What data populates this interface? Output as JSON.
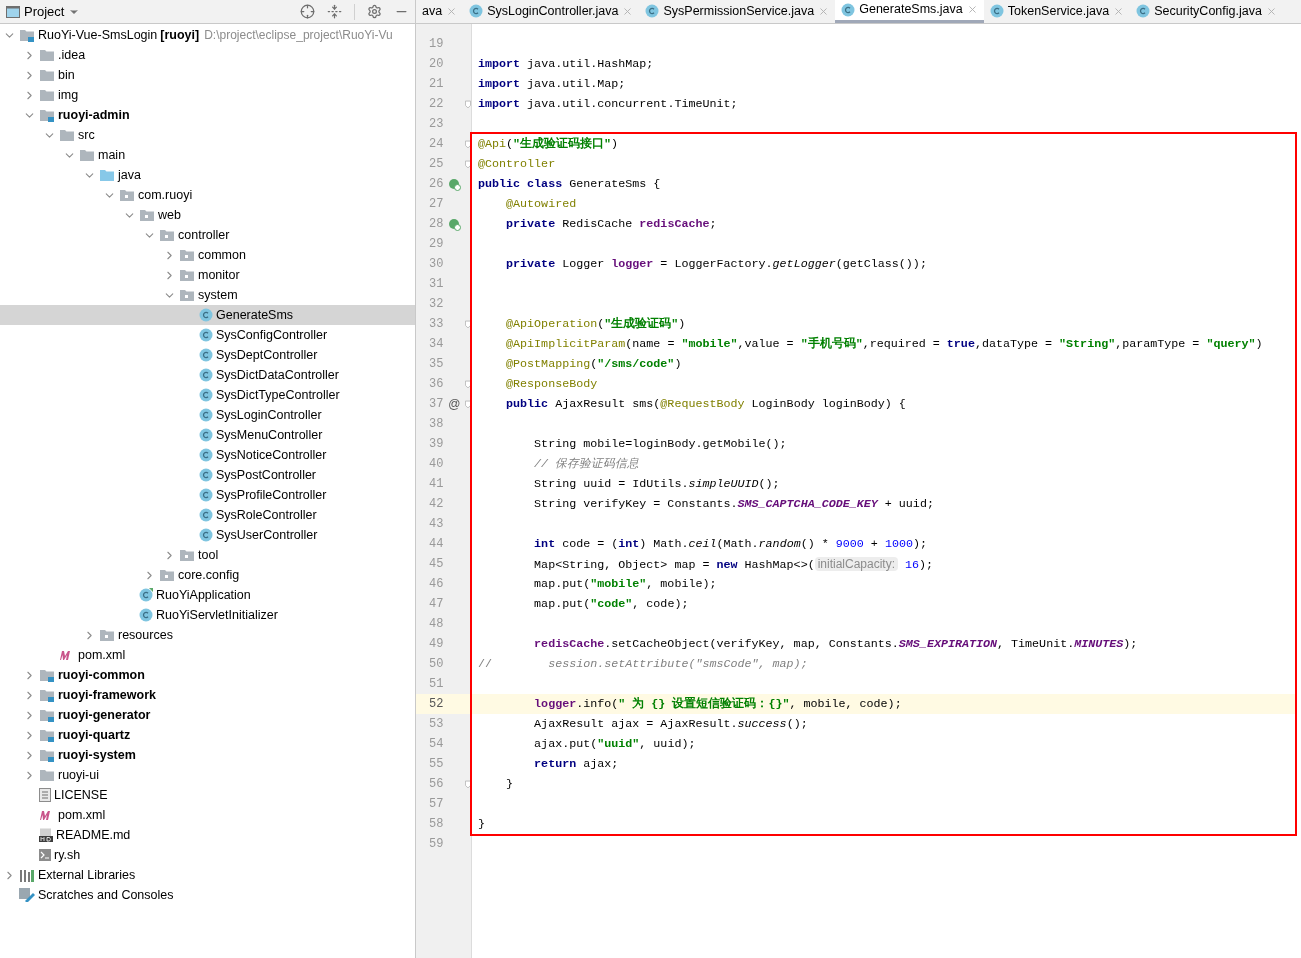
{
  "project_panel": {
    "title": "Project"
  },
  "tree": [
    {
      "kind": "module",
      "name": "RuoYi-Vue-SmsLogin",
      "tag": "[ruoyi]",
      "path": "D:\\project\\eclipse_project\\RuoYi-Vu",
      "expanded": true,
      "selected": false,
      "children": [
        {
          "kind": "folder",
          "name": ".idea",
          "expanded": false,
          "selected": false
        },
        {
          "kind": "folder",
          "name": "bin",
          "expanded": false,
          "selected": false
        },
        {
          "kind": "folder",
          "name": "img",
          "expanded": false,
          "selected": false
        },
        {
          "kind": "module",
          "name": "ruoyi-admin",
          "expanded": true,
          "selected": false,
          "children": [
            {
              "kind": "folder",
              "name": "src",
              "expanded": true,
              "selected": false,
              "children": [
                {
                  "kind": "folder",
                  "name": "main",
                  "expanded": true,
                  "selected": false,
                  "children": [
                    {
                      "kind": "source",
                      "name": "java",
                      "expanded": true,
                      "selected": false,
                      "children": [
                        {
                          "kind": "package",
                          "name": "com.ruoyi",
                          "expanded": true,
                          "selected": false,
                          "children": [
                            {
                              "kind": "package",
                              "name": "web",
                              "expanded": true,
                              "selected": false,
                              "children": [
                                {
                                  "kind": "package",
                                  "name": "controller",
                                  "expanded": true,
                                  "selected": false,
                                  "children": [
                                    {
                                      "kind": "package",
                                      "name": "common",
                                      "expanded": false,
                                      "selected": false
                                    },
                                    {
                                      "kind": "package",
                                      "name": "monitor",
                                      "expanded": false,
                                      "selected": false
                                    },
                                    {
                                      "kind": "package",
                                      "name": "system",
                                      "expanded": true,
                                      "selected": false,
                                      "children": [
                                        {
                                          "kind": "class",
                                          "name": "GenerateSms",
                                          "selected": true
                                        },
                                        {
                                          "kind": "class",
                                          "name": "SysConfigController",
                                          "selected": false
                                        },
                                        {
                                          "kind": "class",
                                          "name": "SysDeptController",
                                          "selected": false
                                        },
                                        {
                                          "kind": "class",
                                          "name": "SysDictDataController",
                                          "selected": false
                                        },
                                        {
                                          "kind": "class",
                                          "name": "SysDictTypeController",
                                          "selected": false
                                        },
                                        {
                                          "kind": "class",
                                          "name": "SysLoginController",
                                          "selected": false
                                        },
                                        {
                                          "kind": "class",
                                          "name": "SysMenuController",
                                          "selected": false
                                        },
                                        {
                                          "kind": "class",
                                          "name": "SysNoticeController",
                                          "selected": false
                                        },
                                        {
                                          "kind": "class",
                                          "name": "SysPostController",
                                          "selected": false
                                        },
                                        {
                                          "kind": "class",
                                          "name": "SysProfileController",
                                          "selected": false
                                        },
                                        {
                                          "kind": "class",
                                          "name": "SysRoleController",
                                          "selected": false
                                        },
                                        {
                                          "kind": "class",
                                          "name": "SysUserController",
                                          "selected": false
                                        }
                                      ]
                                    },
                                    {
                                      "kind": "package",
                                      "name": "tool",
                                      "expanded": false,
                                      "selected": false
                                    }
                                  ]
                                },
                                {
                                  "kind": "package",
                                  "name": "core.config",
                                  "expanded": false,
                                  "selected": false
                                }
                              ]
                            },
                            {
                              "kind": "app",
                              "name": "RuoYiApplication",
                              "selected": false
                            },
                            {
                              "kind": "class",
                              "name": "RuoYiServletInitializer",
                              "selected": false
                            }
                          ]
                        }
                      ]
                    },
                    {
                      "kind": "resources",
                      "name": "resources",
                      "expanded": false,
                      "selected": false
                    }
                  ]
                }
              ]
            },
            {
              "kind": "maven",
              "name": "pom.xml",
              "selected": false
            }
          ]
        },
        {
          "kind": "module",
          "name": "ruoyi-common",
          "expanded": false,
          "selected": false
        },
        {
          "kind": "module",
          "name": "ruoyi-framework",
          "expanded": false,
          "selected": false
        },
        {
          "kind": "module",
          "name": "ruoyi-generator",
          "expanded": false,
          "selected": false
        },
        {
          "kind": "module",
          "name": "ruoyi-quartz",
          "expanded": false,
          "selected": false
        },
        {
          "kind": "module",
          "name": "ruoyi-system",
          "expanded": false,
          "selected": false
        },
        {
          "kind": "folder",
          "name": "ruoyi-ui",
          "expanded": false,
          "selected": false
        },
        {
          "kind": "text",
          "name": "LICENSE",
          "selected": false
        },
        {
          "kind": "maven",
          "name": "pom.xml",
          "selected": false
        },
        {
          "kind": "markdown",
          "name": "README.md",
          "selected": false
        },
        {
          "kind": "shell",
          "name": "ry.sh",
          "selected": false
        }
      ]
    },
    {
      "kind": "libraries",
      "name": "External Libraries",
      "expanded": false,
      "selected": false
    },
    {
      "kind": "scratches",
      "name": "Scratches and Consoles",
      "selected": false
    }
  ],
  "tabs": [
    {
      "label": "ava",
      "icon": false,
      "selected": false
    },
    {
      "label": "SysLoginController.java",
      "icon": true,
      "selected": false
    },
    {
      "label": "SysPermissionService.java",
      "icon": true,
      "selected": false
    },
    {
      "label": "GenerateSms.java",
      "icon": true,
      "selected": true
    },
    {
      "label": "TokenService.java",
      "icon": true,
      "selected": false
    },
    {
      "label": "SecurityConfig.java",
      "icon": true,
      "selected": false
    }
  ],
  "code": {
    "before": [
      {
        "number": "19",
        "fold": false,
        "current": false
      },
      {
        "number": "20",
        "fold": false,
        "current": false,
        "tokens": [
          {
            "kind": "keyword",
            "text": "import"
          },
          {
            "kind": "plain",
            "text": " java.util.HashMap;"
          }
        ]
      },
      {
        "number": "21",
        "fold": false,
        "current": false,
        "tokens": [
          {
            "kind": "keyword",
            "text": "import"
          },
          {
            "kind": "plain",
            "text": " java.util.Map;"
          }
        ]
      },
      {
        "number": "22",
        "fold": true,
        "current": false,
        "tokens": [
          {
            "kind": "keyword",
            "text": "import"
          },
          {
            "kind": "plain",
            "text": " java.util.concurrent.TimeUnit;"
          }
        ]
      },
      {
        "number": "23",
        "fold": false,
        "current": false
      }
    ],
    "boxed": {
      "color": "#ff0000",
      "lines": [
        {
          "number": "24",
          "fold": true,
          "current": false,
          "tokens": [
            {
              "kind": "annotation",
              "text": "@Api"
            },
            {
              "kind": "plain",
              "text": "("
            },
            {
              "kind": "string",
              "text": "\"生成验证码接口\""
            },
            {
              "kind": "plain",
              "text": ")"
            }
          ]
        },
        {
          "number": "25",
          "fold": true,
          "current": false,
          "tokens": [
            {
              "kind": "annotation",
              "text": "@Controller"
            }
          ]
        },
        {
          "number": "26",
          "fold": false,
          "current": false,
          "gutter": {
            "kind": "bean"
          },
          "tokens": [
            {
              "kind": "keyword",
              "text": "public class"
            },
            {
              "kind": "plain",
              "text": " GenerateSms {"
            }
          ]
        },
        {
          "number": "27",
          "fold": false,
          "current": false,
          "tokens": [
            {
              "kind": "annotation",
              "text": "    @Autowired"
            }
          ]
        },
        {
          "number": "28",
          "fold": false,
          "current": false,
          "gutter": {
            "kind": "bean"
          },
          "tokens": [
            {
              "kind": "keyword",
              "text": "    private"
            },
            {
              "kind": "plain",
              "text": " RedisCache "
            },
            {
              "kind": "field",
              "text": "redisCache"
            },
            {
              "kind": "plain",
              "text": ";"
            }
          ]
        },
        {
          "number": "29",
          "fold": false,
          "current": false
        },
        {
          "number": "30",
          "fold": false,
          "current": false,
          "tokens": [
            {
              "kind": "keyword",
              "text": "    private"
            },
            {
              "kind": "plain",
              "text": " Logger "
            },
            {
              "kind": "field",
              "text": "logger"
            },
            {
              "kind": "plain",
              "text": " = LoggerFactory."
            },
            {
              "kind": "italic",
              "text": "getLogger"
            },
            {
              "kind": "plain",
              "text": "(getClass());"
            }
          ]
        },
        {
          "number": "31",
          "fold": false,
          "current": false
        },
        {
          "number": "32",
          "fold": false,
          "current": false
        },
        {
          "number": "33",
          "fold": true,
          "current": false,
          "tokens": [
            {
              "kind": "annotation",
              "text": "    @ApiOperation"
            },
            {
              "kind": "plain",
              "text": "("
            },
            {
              "kind": "string",
              "text": "\"生成验证码\""
            },
            {
              "kind": "plain",
              "text": ")"
            }
          ]
        },
        {
          "number": "34",
          "fold": false,
          "current": false,
          "tokens": [
            {
              "kind": "annotation",
              "text": "    @ApiImplicitParam"
            },
            {
              "kind": "plain",
              "text": "(name = "
            },
            {
              "kind": "string",
              "text": "\"mobile\""
            },
            {
              "kind": "plain",
              "text": ",value = "
            },
            {
              "kind": "string",
              "text": "\"手机号码\""
            },
            {
              "kind": "plain",
              "text": ",required = "
            },
            {
              "kind": "keyword",
              "text": "true"
            },
            {
              "kind": "plain",
              "text": ",dataType = "
            },
            {
              "kind": "string",
              "text": "\"String\""
            },
            {
              "kind": "plain",
              "text": ",paramType = "
            },
            {
              "kind": "string",
              "text": "\"query\""
            },
            {
              "kind": "plain",
              "text": ")"
            }
          ]
        },
        {
          "number": "35",
          "fold": false,
          "current": false,
          "tokens": [
            {
              "kind": "annotation",
              "text": "    @PostMapping"
            },
            {
              "kind": "plain",
              "text": "("
            },
            {
              "kind": "string",
              "text": "\"/sms/code\""
            },
            {
              "kind": "plain",
              "text": ")"
            }
          ]
        },
        {
          "number": "36",
          "fold": true,
          "current": false,
          "tokens": [
            {
              "kind": "annotation",
              "text": "    @ResponseBody"
            }
          ]
        },
        {
          "number": "37",
          "fold": true,
          "current": false,
          "marker": "@",
          "tokens": [
            {
              "kind": "keyword",
              "text": "    public"
            },
            {
              "kind": "plain",
              "text": " AjaxResult sms("
            },
            {
              "kind": "annotation",
              "text": "@RequestBody"
            },
            {
              "kind": "plain",
              "text": " LoginBody loginBody) {"
            }
          ]
        },
        {
          "number": "38",
          "fold": false,
          "current": false
        },
        {
          "number": "39",
          "fold": false,
          "current": false,
          "tokens": [
            {
              "kind": "plain",
              "text": "        String mobile=loginBody.getMobile();"
            }
          ]
        },
        {
          "number": "40",
          "fold": false,
          "current": false,
          "tokens": [
            {
              "kind": "comment",
              "text": "        // 保存验证码信息"
            }
          ]
        },
        {
          "number": "41",
          "fold": false,
          "current": false,
          "tokens": [
            {
              "kind": "plain",
              "text": "        String uuid = IdUtils."
            },
            {
              "kind": "italic",
              "text": "simpleUUID"
            },
            {
              "kind": "plain",
              "text": "();"
            }
          ]
        },
        {
          "number": "42",
          "fold": false,
          "current": false,
          "tokens": [
            {
              "kind": "plain",
              "text": "        String verifyKey = Constants."
            },
            {
              "kind": "static",
              "text": "SMS_CAPTCHA_CODE_KEY"
            },
            {
              "kind": "plain",
              "text": " + uuid;"
            }
          ]
        },
        {
          "number": "43",
          "fold": false,
          "current": false
        },
        {
          "number": "44",
          "fold": false,
          "current": false,
          "tokens": [
            {
              "kind": "keyword",
              "text": "        int"
            },
            {
              "kind": "plain",
              "text": " code = ("
            },
            {
              "kind": "keyword",
              "text": "int"
            },
            {
              "kind": "plain",
              "text": ") Math."
            },
            {
              "kind": "italic",
              "text": "ceil"
            },
            {
              "kind": "plain",
              "text": "(Math."
            },
            {
              "kind": "italic",
              "text": "random"
            },
            {
              "kind": "plain",
              "text": "() * "
            },
            {
              "kind": "number",
              "text": "9000"
            },
            {
              "kind": "plain",
              "text": " + "
            },
            {
              "kind": "number",
              "text": "1000"
            },
            {
              "kind": "plain",
              "text": ");"
            }
          ]
        },
        {
          "number": "45",
          "fold": false,
          "current": false,
          "tokens": [
            {
              "kind": "plain",
              "text": "        Map<String, Object> map = "
            },
            {
              "kind": "keyword",
              "text": "new"
            },
            {
              "kind": "plain",
              "text": " HashMap<>("
            },
            {
              "kind": "hint",
              "text": "initialCapacity:"
            },
            {
              "kind": "number",
              "text": " 16"
            },
            {
              "kind": "plain",
              "text": ");"
            }
          ]
        },
        {
          "number": "46",
          "fold": false,
          "current": false,
          "tokens": [
            {
              "kind": "plain",
              "text": "        map.put("
            },
            {
              "kind": "string",
              "text": "\"mobile\""
            },
            {
              "kind": "plain",
              "text": ", mobile);"
            }
          ]
        },
        {
          "number": "47",
          "fold": false,
          "current": false,
          "tokens": [
            {
              "kind": "plain",
              "text": "        map.put("
            },
            {
              "kind": "string",
              "text": "\"code\""
            },
            {
              "kind": "plain",
              "text": ", code);"
            }
          ]
        },
        {
          "number": "48",
          "fold": false,
          "current": false
        },
        {
          "number": "49",
          "fold": false,
          "current": false,
          "tokens": [
            {
              "kind": "field",
              "text": "        redisCache"
            },
            {
              "kind": "plain",
              "text": ".setCacheObject(verifyKey, map, Constants."
            },
            {
              "kind": "static",
              "text": "SMS_EXPIRATION"
            },
            {
              "kind": "plain",
              "text": ", TimeUnit."
            },
            {
              "kind": "static",
              "text": "MINUTES"
            },
            {
              "kind": "plain",
              "text": ");"
            }
          ]
        },
        {
          "number": "50",
          "fold": false,
          "current": false,
          "tokens": [
            {
              "kind": "linecomment",
              "text": "//"
            },
            {
              "kind": "comment",
              "text": "        session.setAttribute(\"smsCode\", map);"
            }
          ]
        },
        {
          "number": "51",
          "fold": false,
          "current": false
        },
        {
          "number": "52",
          "fold": false,
          "current": true,
          "tokens": [
            {
              "kind": "field",
              "text": "        logger"
            },
            {
              "kind": "plain",
              "text": ".info("
            },
            {
              "kind": "string",
              "text": "\" 为 {} 设置短信验证码：{}\""
            },
            {
              "kind": "plain",
              "text": ", mobile, code);"
            }
          ]
        },
        {
          "number": "53",
          "fold": false,
          "current": false,
          "tokens": [
            {
              "kind": "plain",
              "text": "        AjaxResult ajax = AjaxResult."
            },
            {
              "kind": "italic",
              "text": "success"
            },
            {
              "kind": "plain",
              "text": "();"
            }
          ]
        },
        {
          "number": "54",
          "fold": false,
          "current": false,
          "tokens": [
            {
              "kind": "plain",
              "text": "        ajax.put("
            },
            {
              "kind": "string",
              "text": "\"uuid\""
            },
            {
              "kind": "plain",
              "text": ", uuid);"
            }
          ]
        },
        {
          "number": "55",
          "fold": false,
          "current": false,
          "tokens": [
            {
              "kind": "keyword",
              "text": "        return"
            },
            {
              "kind": "plain",
              "text": " ajax;"
            }
          ]
        },
        {
          "number": "56",
          "fold": true,
          "current": false,
          "tokens": [
            {
              "kind": "plain",
              "text": "    }"
            }
          ]
        },
        {
          "number": "57",
          "fold": false,
          "current": false
        },
        {
          "number": "58",
          "fold": false,
          "current": false,
          "tokens": [
            {
              "kind": "plain",
              "text": "}"
            }
          ]
        }
      ]
    },
    "after": [
      {
        "number": "59",
        "fold": false,
        "current": false
      }
    ]
  }
}
